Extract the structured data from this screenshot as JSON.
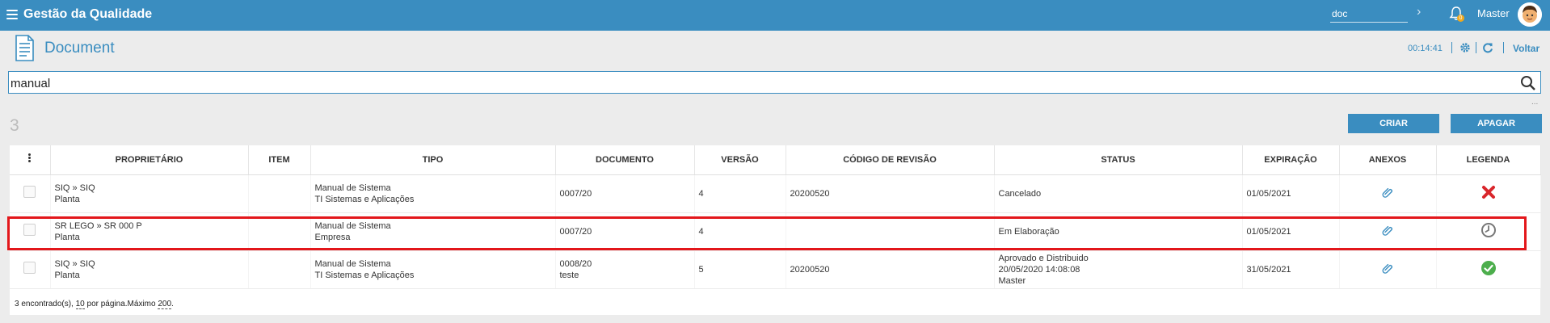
{
  "topbar": {
    "app_title": "Gestão da Qualidade",
    "search_value": "doc",
    "user_name": "Master",
    "notification_count": "0"
  },
  "page": {
    "title": "Document",
    "timer": "00:14:41",
    "back_label": "Voltar"
  },
  "search": {
    "value": "manual",
    "more": "..."
  },
  "result_count": "3",
  "actions": {
    "create_label": "CRIAR",
    "delete_label": "APAGAR"
  },
  "table": {
    "headers": {
      "owner": "PROPRIETÁRIO",
      "item": "ITEM",
      "type": "TIPO",
      "document": "DOCUMENTO",
      "version": "VERSÃO",
      "revision_code": "CÓDIGO DE REVISÃO",
      "status": "STATUS",
      "expiration": "EXPIRAÇÃO",
      "attachments": "ANEXOS",
      "legend": "LEGENDA"
    },
    "rows": [
      {
        "owner_line1": "SIQ » SIQ",
        "owner_line2": "Planta",
        "item": "",
        "type_line1": "Manual de Sistema",
        "type_line2": "TI Sistemas e Aplicações",
        "document_line1": "0007/20",
        "document_line2": "",
        "version": "4",
        "revision_code": "20200520",
        "status_line1": "Cancelado",
        "status_line2": "",
        "status_line3": "",
        "expiration": "01/05/2021",
        "legend_icon": "cancelled-x-icon",
        "legend_color": "#d9262b"
      },
      {
        "owner_line1": "SR LEGO » SR 000 P",
        "owner_line2": "Planta",
        "item": "",
        "type_line1": "Manual de Sistema",
        "type_line2": "Empresa",
        "document_line1": "0007/20",
        "document_line2": "",
        "version": "4",
        "revision_code": "",
        "status_line1": "Em Elaboração",
        "status_line2": "",
        "status_line3": "",
        "expiration": "01/05/2021",
        "legend_icon": "clock-icon",
        "legend_color": "#777777"
      },
      {
        "owner_line1": "SIQ » SIQ",
        "owner_line2": "Planta",
        "item": "",
        "type_line1": "Manual de Sistema",
        "type_line2": "TI Sistemas e Aplicações",
        "document_line1": "0008/20",
        "document_line2": "teste",
        "version": "5",
        "revision_code": "20200520",
        "status_line1": "Aprovado e Distribuido",
        "status_line2": "20/05/2020 14:08:08",
        "status_line3": "Master",
        "expiration": "31/05/2021",
        "legend_icon": "approved-check-icon",
        "legend_color": "#4cae4c"
      }
    ]
  },
  "footer": {
    "part1": "3 encontrado(s), ",
    "per_page": "10",
    "part2": " por página.Máximo ",
    "max": "200",
    "part3": "."
  },
  "colors": {
    "brand": "#3a8dc0",
    "highlight": "#e3171b"
  }
}
